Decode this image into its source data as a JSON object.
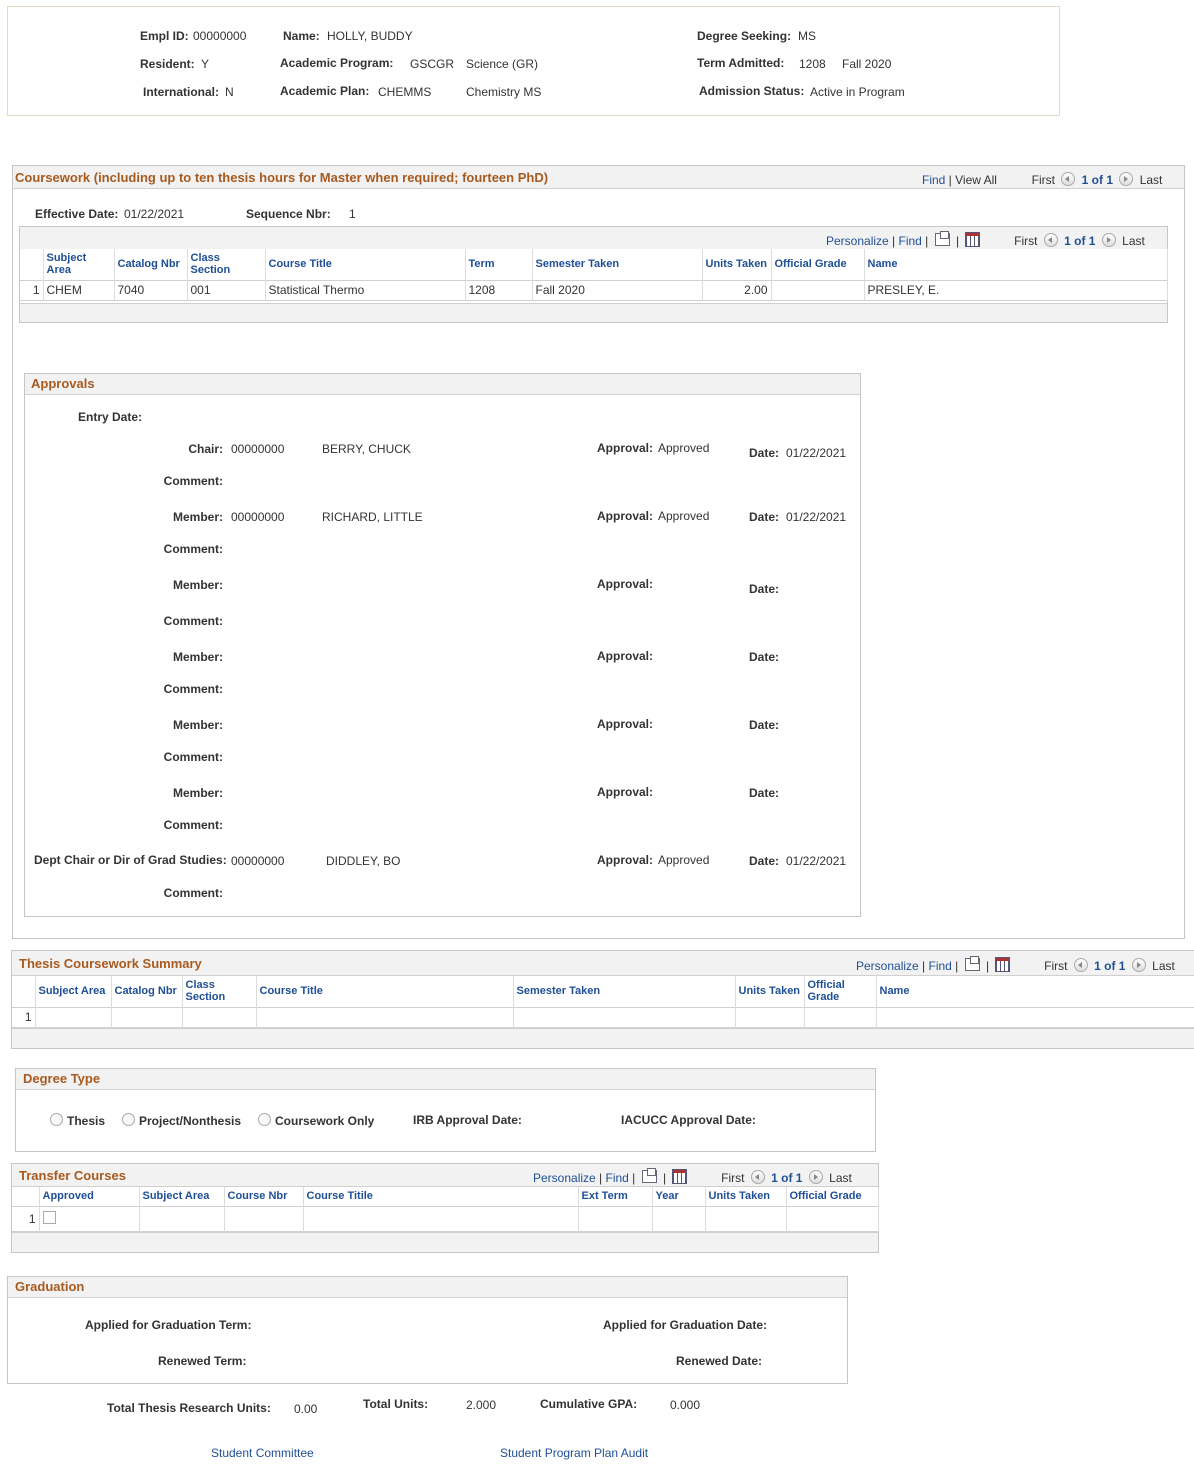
{
  "student": {
    "empl_id_label": "Empl ID:",
    "empl_id": "00000000",
    "name_label": "Name:",
    "name": "HOLLY, BUDDY",
    "degree_seeking_label": "Degree Seeking:",
    "degree_seeking": "MS",
    "resident_label": "Resident:",
    "resident": "Y",
    "program_label": "Academic Program:",
    "program_code": "GSCGR",
    "program_desc": "Science (GR)",
    "term_admitted_label": "Term Admitted:",
    "term_admitted_code": "1208",
    "term_admitted_desc": "Fall 2020",
    "international_label": "International:",
    "international": "N",
    "plan_label": "Academic Plan:",
    "plan_code": "CHEMMS",
    "plan_desc": "Chemistry MS",
    "admission_status_label": "Admission Status:",
    "admission_status": "Active in Program"
  },
  "coursework": {
    "title": "Coursework (including up to ten thesis hours for Master when required; fourteen PhD)",
    "find": "Find",
    "view_all": "View All",
    "first": "First",
    "count": "1 of 1",
    "last": "Last",
    "effective_date_label": "Effective Date:",
    "effective_date": "01/22/2021",
    "sequence_label": "Sequence Nbr:",
    "sequence": "1",
    "grid_nav": {
      "personalize": "Personalize",
      "find": "Find",
      "first": "First",
      "count": "1 of 1",
      "last": "Last"
    },
    "columns": [
      "Subject Area",
      "Catalog Nbr",
      "Class Section",
      "Course Title",
      "Term",
      "Semester Taken",
      "Units Taken",
      "Official Grade",
      "Name"
    ],
    "rows": [
      {
        "num": "1",
        "subject": "CHEM",
        "catalog": "7040",
        "section": "001",
        "title": "Statistical Thermo",
        "term": "1208",
        "semester": "Fall 2020",
        "units": "2.00",
        "grade": "",
        "name": "PRESLEY, E."
      }
    ]
  },
  "approvals": {
    "title": "Approvals",
    "entry_date_label": "Entry Date:",
    "comment_label": "Comment:",
    "approval_label": "Approval:",
    "date_label": "Date:",
    "chair": {
      "label": "Chair:",
      "id": "00000000",
      "name": "BERRY, CHUCK",
      "approval": "Approved",
      "date": "01/22/2021"
    },
    "members": [
      {
        "label": "Member:",
        "id": "00000000",
        "name": "RICHARD, LITTLE",
        "approval": "Approved",
        "date": "01/22/2021"
      },
      {
        "label": "Member:",
        "id": "",
        "name": "",
        "approval": "",
        "date": ""
      },
      {
        "label": "Member:",
        "id": "",
        "name": "",
        "approval": "",
        "date": ""
      },
      {
        "label": "Member:",
        "id": "",
        "name": "",
        "approval": "",
        "date": ""
      },
      {
        "label": "Member:",
        "id": "",
        "name": "",
        "approval": "",
        "date": ""
      }
    ],
    "dept_chair": {
      "label": "Dept Chair or Dir of Grad Studies:",
      "id": "00000000",
      "name": "DIDDLEY, BO",
      "approval": "Approved",
      "date": "01/22/2021"
    }
  },
  "thesis_summary": {
    "title": "Thesis Coursework Summary",
    "nav": {
      "personalize": "Personalize",
      "find": "Find",
      "first": "First",
      "count": "1 of 1",
      "last": "Last"
    },
    "columns": [
      "Subject Area",
      "Catalog Nbr",
      "Class Section",
      "Course Title",
      "Semester Taken",
      "Units Taken",
      "Official Grade",
      "Name"
    ],
    "row_num": "1"
  },
  "degree_type": {
    "title": "Degree Type",
    "opt_thesis": "Thesis",
    "opt_project": "Project/Nonthesis",
    "opt_coursework": "Coursework Only",
    "irb_label": "IRB Approval Date:",
    "iacucc_label": "IACUCC Approval Date:"
  },
  "transfer": {
    "title": "Transfer Courses",
    "nav": {
      "personalize": "Personalize",
      "find": "Find",
      "first": "First",
      "count": "1 of 1",
      "last": "Last"
    },
    "columns": [
      "Approved",
      "Subject Area",
      "Course Nbr",
      "Course Titile",
      "Ext Term",
      "Year",
      "Units Taken",
      "Official Grade"
    ],
    "row_num": "1"
  },
  "graduation": {
    "title": "Graduation",
    "applied_term_label": "Applied for Graduation Term:",
    "applied_date_label": "Applied for Graduation Date:",
    "renewed_term_label": "Renewed Term:",
    "renewed_date_label": "Renewed Date:"
  },
  "totals": {
    "thesis_units_label": "Total Thesis Research Units:",
    "thesis_units": "0.00",
    "total_units_label": "Total Units:",
    "total_units": "2.000",
    "gpa_label": "Cumulative GPA:",
    "gpa": "0.000"
  },
  "links": {
    "committee": "Student Committee",
    "audit": "Student Program Plan Audit"
  }
}
